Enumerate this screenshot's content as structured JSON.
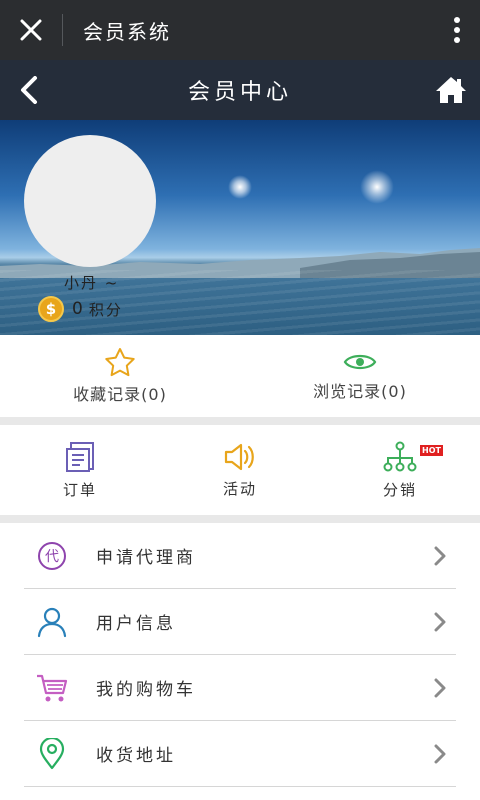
{
  "topbar": {
    "title": "会员系统",
    "close_icon": "close-icon",
    "more_icon": "more-vertical-icon"
  },
  "navbar": {
    "title": "会员中心",
    "back_icon": "chevron-left-icon",
    "home_icon": "home-icon"
  },
  "profile": {
    "username": "小丹 ~",
    "points_value": "0",
    "points_unit": "积分",
    "coin_symbol": "$"
  },
  "records": [
    {
      "label": "收藏记录(0)",
      "icon": "star-icon"
    },
    {
      "label": "浏览记录(0)",
      "icon": "eye-icon"
    }
  ],
  "quick": [
    {
      "label": "订单",
      "icon": "order-icon"
    },
    {
      "label": "活动",
      "icon": "speaker-icon"
    },
    {
      "label": "分销",
      "icon": "distribution-icon",
      "badge": "HOT"
    }
  ],
  "menu": [
    {
      "label": "申请代理商",
      "icon": "agent-icon",
      "icon_text": "代"
    },
    {
      "label": "用户信息",
      "icon": "user-icon"
    },
    {
      "label": "我的购物车",
      "icon": "cart-icon"
    },
    {
      "label": "收货地址",
      "icon": "location-icon"
    }
  ],
  "colors": {
    "topbar": "#2b2d30",
    "navbar": "#252d3a",
    "star": "#e8a51b",
    "eye": "#3dae5a",
    "order": "#6b5fb5",
    "speaker": "#e8a51b",
    "distribution": "#3dae5a",
    "agent": "#8e44ad",
    "user": "#2980b9",
    "cart": "#c45ec2",
    "location": "#27ae60"
  }
}
